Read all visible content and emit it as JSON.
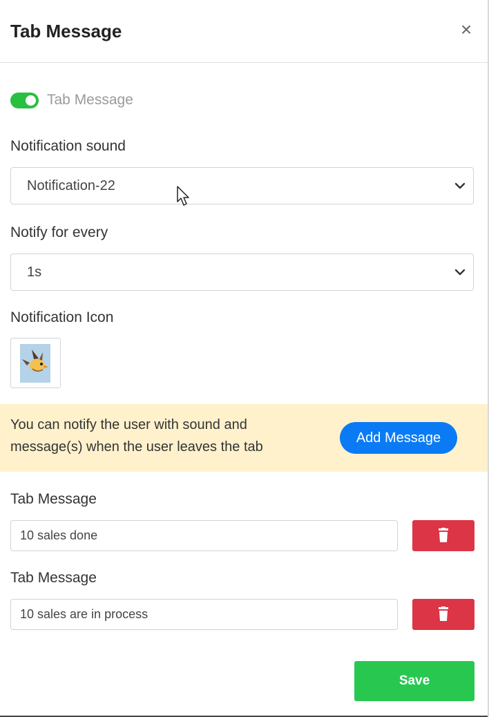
{
  "header": {
    "title": "Tab Message",
    "close_glyph": "×"
  },
  "toggle": {
    "label": "Tab Message",
    "enabled": true,
    "on_color": "#28c040"
  },
  "sound": {
    "label": "Notification sound",
    "selected": "Notification-22",
    "icon": "chevron-down-icon"
  },
  "frequency": {
    "label": "Notify for every",
    "selected": "1s",
    "icon": "chevron-down-icon"
  },
  "icon_section": {
    "label": "Notification Icon",
    "image": "bird-image"
  },
  "notice": {
    "line1": "You can notify the user with sound and",
    "line2": "message(s) when the user leaves the tab",
    "add_button": "Add Message",
    "background": "#fff1cc",
    "button_color": "#0a7bf5"
  },
  "messages": [
    {
      "label": "Tab Message",
      "value": "10 sales done",
      "delete_icon": "trash-icon"
    },
    {
      "label": "Tab Message",
      "value": "10 sales are in process",
      "delete_icon": "trash-icon"
    }
  ],
  "footer": {
    "save_label": "Save",
    "save_color": "#28c850",
    "delete_color": "#dc3545"
  }
}
